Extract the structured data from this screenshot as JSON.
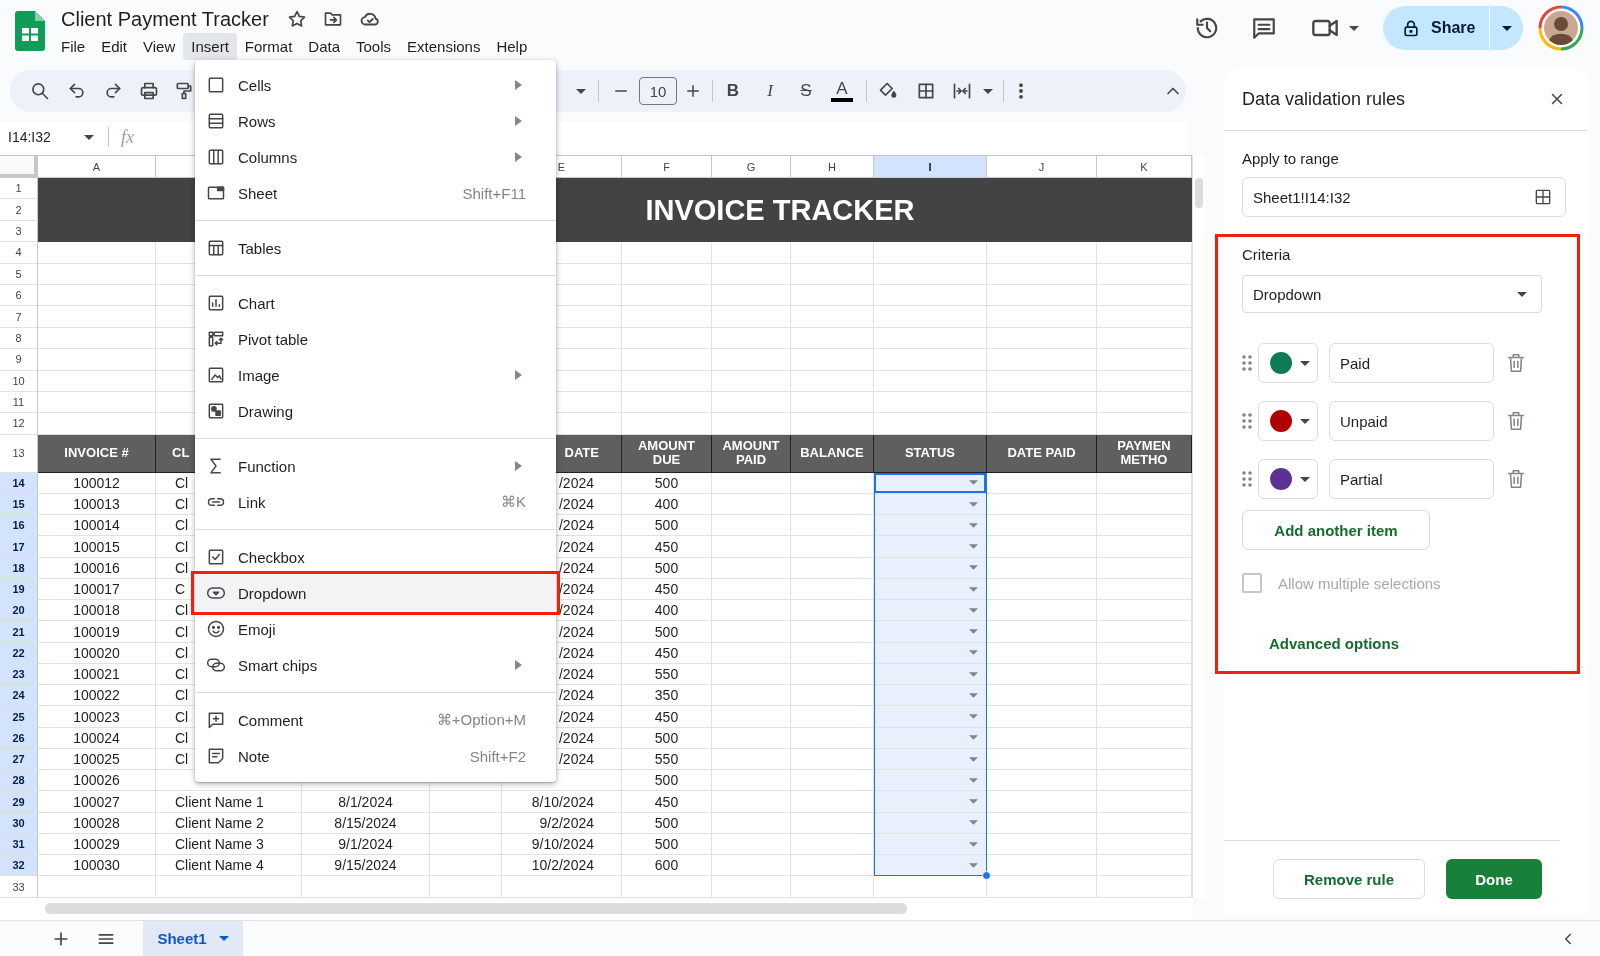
{
  "app": {
    "title": "Client Payment Tracker"
  },
  "menubar": [
    {
      "label": "File",
      "selected": false
    },
    {
      "label": "Edit",
      "selected": false
    },
    {
      "label": "View",
      "selected": false
    },
    {
      "label": "Insert",
      "selected": true
    },
    {
      "label": "Format",
      "selected": false
    },
    {
      "label": "Data",
      "selected": false
    },
    {
      "label": "Tools",
      "selected": false
    },
    {
      "label": "Extensions",
      "selected": false
    },
    {
      "label": "Help",
      "selected": false
    }
  ],
  "account": {
    "share_label": "Share"
  },
  "toolbar": {
    "font_size": "10",
    "bold": "B",
    "italic": "I",
    "strikethrough": "S",
    "text_color": "A"
  },
  "formula_bar": {
    "name_box": "I14:I32",
    "fx": "fx"
  },
  "insert_menu": {
    "groups": [
      [
        {
          "label": "Cells",
          "submenu": true,
          "selected": false
        },
        {
          "label": "Rows",
          "submenu": true,
          "selected": false
        },
        {
          "label": "Columns",
          "submenu": true,
          "selected": false
        },
        {
          "label": "Sheet",
          "submenu": false,
          "selected": false,
          "shortcut": "Shift+F11"
        }
      ],
      [
        {
          "label": "Tables",
          "submenu": false,
          "selected": false
        }
      ],
      [
        {
          "label": "Chart",
          "submenu": false,
          "selected": false
        },
        {
          "label": "Pivot table",
          "submenu": false,
          "selected": false
        },
        {
          "label": "Image",
          "submenu": true,
          "selected": false
        },
        {
          "label": "Drawing",
          "submenu": false,
          "selected": false
        }
      ],
      [
        {
          "label": "Function",
          "submenu": true,
          "selected": false
        },
        {
          "label": "Link",
          "submenu": false,
          "selected": false,
          "shortcut": "⌘K"
        }
      ],
      [
        {
          "label": "Checkbox",
          "submenu": false,
          "selected": false
        },
        {
          "label": "Dropdown",
          "submenu": false,
          "selected": true
        },
        {
          "label": "Emoji",
          "submenu": false,
          "selected": false
        },
        {
          "label": "Smart chips",
          "submenu": true,
          "selected": false
        }
      ],
      [
        {
          "label": "Comment",
          "submenu": false,
          "selected": false,
          "shortcut": "⌘+Option+M"
        },
        {
          "label": "Note",
          "submenu": false,
          "selected": false,
          "shortcut": "Shift+F2"
        }
      ]
    ]
  },
  "sheet": {
    "columns": [
      {
        "label": "A",
        "selected": false
      },
      {
        "label": "E",
        "selected": false
      },
      {
        "label": "F",
        "selected": false
      },
      {
        "label": "G",
        "selected": false
      },
      {
        "label": "H",
        "selected": false
      },
      {
        "label": "I",
        "selected": true
      },
      {
        "label": "J",
        "selected": false
      },
      {
        "label": "K",
        "selected": false
      }
    ],
    "banner": {
      "row_numbers": [
        "1",
        "2",
        "3"
      ],
      "title": "INVOICE TRACKER"
    },
    "blank_rows": [
      "4",
      "5",
      "6",
      "7",
      "8",
      "9",
      "10",
      "11",
      "12"
    ],
    "header_row": {
      "number": "13",
      "invoice_number": "INVOICE #",
      "client": "CL",
      "due_date": "DATE",
      "amount_due": "AMOUNT\nDUE",
      "amount_paid": "AMOUNT\nPAID",
      "balance": "BALANCE",
      "status": "STATUS",
      "date_paid": "DATE PAID",
      "payment_method": "PAYMEN\nMETHO"
    },
    "rows": [
      {
        "number": "14",
        "selected": true,
        "active": true,
        "invoice_number": "100012",
        "client": "Cl",
        "due_date": "/2024",
        "amount_due": "500",
        "status_dropdown": true
      },
      {
        "number": "15",
        "selected": true,
        "active": false,
        "invoice_number": "100013",
        "client": "Cl",
        "due_date": "/2024",
        "amount_due": "400",
        "status_dropdown": true
      },
      {
        "number": "16",
        "selected": true,
        "active": false,
        "invoice_number": "100014",
        "client": "Cl",
        "due_date": "/2024",
        "amount_due": "500",
        "status_dropdown": true
      },
      {
        "number": "17",
        "selected": true,
        "active": false,
        "invoice_number": "100015",
        "client": "Cl",
        "due_date": "/2024",
        "amount_due": "450",
        "status_dropdown": true
      },
      {
        "number": "18",
        "selected": true,
        "active": false,
        "invoice_number": "100016",
        "client": "Cl",
        "due_date": "/2024",
        "amount_due": "500",
        "status_dropdown": true
      },
      {
        "number": "19",
        "selected": true,
        "active": false,
        "invoice_number": "100017",
        "client": "C",
        "due_date": "/2024",
        "amount_due": "450",
        "status_dropdown": true
      },
      {
        "number": "20",
        "selected": true,
        "active": false,
        "invoice_number": "100018",
        "client": "Cl",
        "due_date": "/2024",
        "amount_due": "400",
        "status_dropdown": true
      },
      {
        "number": "21",
        "selected": true,
        "active": false,
        "invoice_number": "100019",
        "client": "Cl",
        "due_date": "/2024",
        "amount_due": "500",
        "status_dropdown": true
      },
      {
        "number": "22",
        "selected": true,
        "active": false,
        "invoice_number": "100020",
        "client": "Cl",
        "due_date": "/2024",
        "amount_due": "450",
        "status_dropdown": true
      },
      {
        "number": "23",
        "selected": true,
        "active": false,
        "invoice_number": "100021",
        "client": "Cl",
        "due_date": "/2024",
        "amount_due": "550",
        "status_dropdown": true
      },
      {
        "number": "24",
        "selected": true,
        "active": false,
        "invoice_number": "100022",
        "client": "Cl",
        "due_date": "/2024",
        "amount_due": "350",
        "status_dropdown": true
      },
      {
        "number": "25",
        "selected": true,
        "active": false,
        "invoice_number": "100023",
        "client": "Cl",
        "due_date": "/2024",
        "amount_due": "450",
        "status_dropdown": true
      },
      {
        "number": "26",
        "selected": true,
        "active": false,
        "invoice_number": "100024",
        "client": "Cl",
        "due_date": "/2024",
        "amount_due": "500",
        "status_dropdown": true
      },
      {
        "number": "27",
        "selected": true,
        "active": false,
        "invoice_number": "100025",
        "client": "Cl",
        "due_date": "/2024",
        "amount_due": "550",
        "status_dropdown": true
      },
      {
        "number": "28",
        "selected": true,
        "active": false,
        "invoice_number": "100026",
        "amount_due": "500",
        "status_dropdown": true
      },
      {
        "number": "29",
        "selected": true,
        "active": false,
        "invoice_number": "100027",
        "client": "Client Name 1",
        "issue_date": "8/1/2024",
        "due_date": "8/10/2024",
        "amount_due": "450",
        "status_dropdown": true
      },
      {
        "number": "30",
        "selected": true,
        "active": false,
        "invoice_number": "100028",
        "client": "Client Name 2",
        "issue_date": "8/15/2024",
        "due_date": "9/2/2024",
        "amount_due": "500",
        "status_dropdown": true
      },
      {
        "number": "31",
        "selected": true,
        "active": false,
        "invoice_number": "100029",
        "client": "Client Name 3",
        "issue_date": "9/1/2024",
        "due_date": "9/10/2024",
        "amount_due": "500",
        "status_dropdown": true
      },
      {
        "number": "32",
        "selected": true,
        "active": false,
        "invoice_number": "100030",
        "client": "Client Name 4",
        "issue_date": "9/15/2024",
        "due_date": "10/2/2024",
        "amount_due": "600",
        "status_dropdown": true
      }
    ],
    "trailing_rows": [
      "33"
    ]
  },
  "validation_panel": {
    "title": "Data validation rules",
    "range_label": "Apply to range",
    "range_value": "Sheet1!I14:I32",
    "criteria": {
      "highlighted": true,
      "label": "Criteria",
      "type": "Dropdown",
      "items": [
        {
          "color": "#0f7b55",
          "value": "Paid"
        },
        {
          "color": "#b10202",
          "value": "Unpaid"
        },
        {
          "color": "#5b3291",
          "value": "Partial"
        }
      ],
      "add_item": "Add another item",
      "allow_multiple": {
        "label": "Allow multiple selections",
        "checked": false,
        "disabled": true
      },
      "advanced": "Advanced options"
    },
    "buttons": [
      {
        "label": "Remove rule",
        "kind": "secondary"
      },
      {
        "label": "Done",
        "kind": "primary"
      }
    ]
  },
  "sheet_tabs": [
    {
      "label": "Sheet1",
      "selected": true
    }
  ]
}
